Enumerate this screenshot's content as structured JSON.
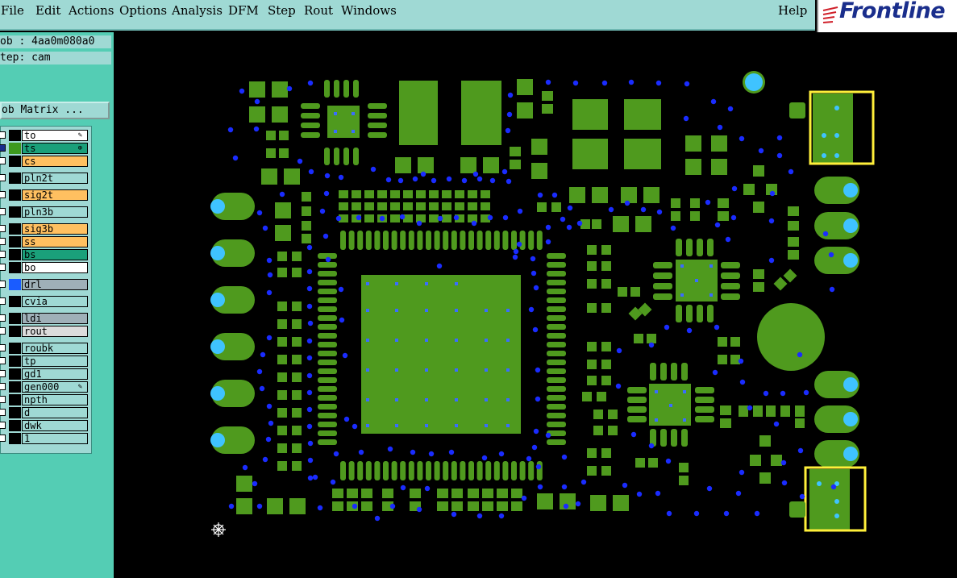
{
  "menubar": {
    "items": [
      {
        "label": "File",
        "name": "menu-file"
      },
      {
        "label": "Edit",
        "name": "menu-edit"
      },
      {
        "label": "Actions",
        "name": "menu-actions"
      },
      {
        "label": "Options",
        "name": "menu-options"
      },
      {
        "label": "Analysis",
        "name": "menu-analysis"
      },
      {
        "label": "DFM",
        "name": "menu-dfm"
      },
      {
        "label": "Step",
        "name": "menu-step"
      },
      {
        "label": "Rout",
        "name": "menu-rout"
      },
      {
        "label": "Windows",
        "name": "menu-windows"
      }
    ],
    "help": "Help"
  },
  "logo": {
    "text": "Frontline",
    "icon": "frontline-swoosh-icon",
    "color": "#1a2e8c",
    "accent": "#d0202a"
  },
  "job": {
    "label": "ob : 4aa0m080a0"
  },
  "step": {
    "label": "tep: cam"
  },
  "job_matrix": {
    "label": "ob Matrix ..."
  },
  "layers": [
    {
      "name": "to",
      "color": "#ffffff",
      "swatch": "#000000",
      "mark": "✎"
    },
    {
      "name": "ts",
      "color": "#1aa07a",
      "swatch": "#3d9a1e",
      "mark": "⊕",
      "checked": true
    },
    {
      "name": "cs",
      "color": "#ffc060",
      "swatch": "#000000"
    },
    {
      "name": "pln2t",
      "color": "#9fd9d4",
      "swatch": "#000000"
    },
    {
      "name": "sig2t",
      "color": "#ffc060",
      "swatch": "#000000"
    },
    {
      "name": "pln3b",
      "color": "#9fd9d4",
      "swatch": "#000000"
    },
    {
      "name": "sig3b",
      "color": "#ffc060",
      "swatch": "#000000"
    },
    {
      "name": "ss",
      "color": "#ffc060",
      "swatch": "#000000"
    },
    {
      "name": "bs",
      "color": "#1aa07a",
      "swatch": "#000000"
    },
    {
      "name": "bo",
      "color": "#ffffff",
      "swatch": "#000000"
    },
    {
      "name": "drl",
      "color": "#9fb0b8",
      "swatch": "#1a5cff"
    },
    {
      "name": "cvia",
      "color": "#9fd9d4",
      "swatch": "#000000"
    },
    {
      "name": "ldi",
      "color": "#9fb0b8",
      "swatch": "#000000"
    },
    {
      "name": "rout",
      "color": "#dcdcdc",
      "swatch": "#000000"
    },
    {
      "name": "roubk",
      "color": "#9fd9d4",
      "swatch": "#000000"
    },
    {
      "name": "tp",
      "color": "#9fd9d4",
      "swatch": "#000000"
    },
    {
      "name": "gd1",
      "color": "#9fd9d4",
      "swatch": "#000000"
    },
    {
      "name": "gen000",
      "color": "#9fd9d4",
      "swatch": "#000000",
      "mark": "✎"
    },
    {
      "name": "npth",
      "color": "#9fd9d4",
      "swatch": "#000000"
    },
    {
      "name": "d",
      "color": "#9fd9d4",
      "swatch": "#000000"
    },
    {
      "name": "dwk",
      "color": "#9fd9d4",
      "swatch": "#000000"
    },
    {
      "name": "1",
      "color": "#9fd9d4",
      "swatch": "#000000"
    }
  ],
  "colors": {
    "pad": "#4f9a1e",
    "via": "#1a2cff",
    "drill": "#3fc3ff",
    "highlight": "#ffef3a",
    "background": "#000000"
  },
  "canvas": {
    "origin_icon": "origin-crosshair-icon"
  }
}
